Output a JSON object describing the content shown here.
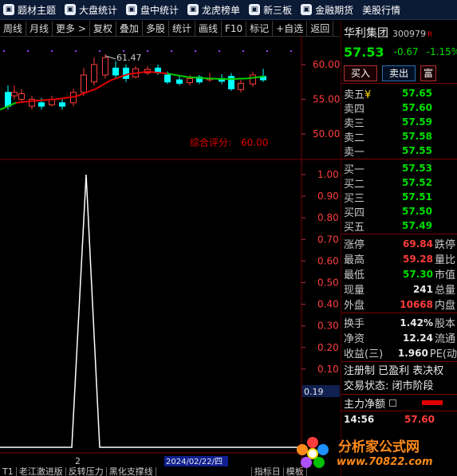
{
  "topnav": [
    {
      "label": "题材主题",
      "icon": "grid-icon"
    },
    {
      "label": "大盘统计",
      "icon": "pie-chart-icon"
    },
    {
      "label": "盘中统计",
      "icon": "monitor-icon"
    },
    {
      "label": "龙虎榜单",
      "icon": "trophy-icon"
    },
    {
      "label": "新三板",
      "icon": "board-icon"
    },
    {
      "label": "金融期货",
      "icon": "futures-icon"
    },
    {
      "label": "美股行情",
      "icon": ""
    }
  ],
  "toolbar": [
    "周线",
    "月线",
    "更多 >",
    "复权",
    "叠加",
    "多股",
    "统计",
    "画线",
    "F10",
    "标记",
    "+自选",
    "返回"
  ],
  "main_chart": {
    "y_ticks": [
      "60.00",
      "55.00",
      "50.00"
    ],
    "high_label": "61.47",
    "score_label": "综合评分: ",
    "score_value": "60.00",
    "colors": {
      "up": "#ff3c3c",
      "down": "#00ffff",
      "ma_up": "#e00000",
      "ma_down": "#00cc00"
    }
  },
  "chart_data": {
    "type": "line",
    "title": "",
    "xlabel": "",
    "ylabel": "",
    "ylim": [
      0,
      1.05
    ],
    "y_ticks": [
      "1.00",
      "0.90",
      "0.80",
      "0.70",
      "0.60",
      "0.50",
      "0.40",
      "0.30",
      "0.20",
      "0.10"
    ],
    "x": [
      0,
      1,
      2,
      3,
      4
    ],
    "values": [
      0,
      0,
      1,
      0,
      0
    ],
    "current_value": "0.19"
  },
  "axis_markers": {
    "left": "2",
    "date": "2024/02/22/四"
  },
  "stock": {
    "name": "华利集团",
    "code": "300979",
    "flag": "R",
    "price": "57.53",
    "change": "-0.67",
    "change_pct": "-1.15%"
  },
  "trade_buttons": [
    "买入",
    "卖出",
    "富"
  ],
  "order_book": {
    "sell": [
      {
        "label": "卖五",
        "mark": "¥",
        "price": "57.65"
      },
      {
        "label": "卖四",
        "mark": "",
        "price": "57.60"
      },
      {
        "label": "卖三",
        "mark": "",
        "price": "57.59"
      },
      {
        "label": "卖二",
        "mark": "",
        "price": "57.58"
      },
      {
        "label": "卖一",
        "mark": "",
        "price": "57.55"
      }
    ],
    "buy": [
      {
        "label": "买一",
        "price": "57.53"
      },
      {
        "label": "买二",
        "price": "57.52"
      },
      {
        "label": "买三",
        "price": "57.51"
      },
      {
        "label": "买四",
        "price": "57.50"
      },
      {
        "label": "买五",
        "price": "57.49"
      }
    ]
  },
  "stats": [
    {
      "label": "涨停",
      "value": "69.84",
      "extra": "跌停",
      "color": "red"
    },
    {
      "label": "最高",
      "value": "59.28",
      "extra": "量比",
      "color": "red"
    },
    {
      "label": "最低",
      "value": "57.30",
      "extra": "市值",
      "color": "green"
    },
    {
      "label": "现量",
      "value": "241",
      "extra": "总量",
      "color": "white"
    },
    {
      "label": "外盘",
      "value": "10668",
      "extra": "内盘",
      "color": "red"
    }
  ],
  "stats2": [
    {
      "label": "换手",
      "value": "1.42%",
      "extra": "股本",
      "color": "white"
    },
    {
      "label": "净资",
      "value": "12.24",
      "extra": "流通",
      "color": "white"
    },
    {
      "label": "收益(三)",
      "value": "1.960",
      "extra": "PE(动",
      "color": "white"
    }
  ],
  "info": [
    "注册制 已盈利 表决权",
    "交易状态: 闭市阶段"
  ],
  "net_flow_label": "主力净额",
  "tick": {
    "time": "14:56",
    "price": "57.60"
  },
  "watermark": {
    "name": "分析家公式网",
    "url": "www.70822.com"
  },
  "bottom_tabs": [
    "T1",
    "老江激进版",
    "反转压力",
    "黑化支撑线",
    "",
    "指标日",
    "模板"
  ]
}
